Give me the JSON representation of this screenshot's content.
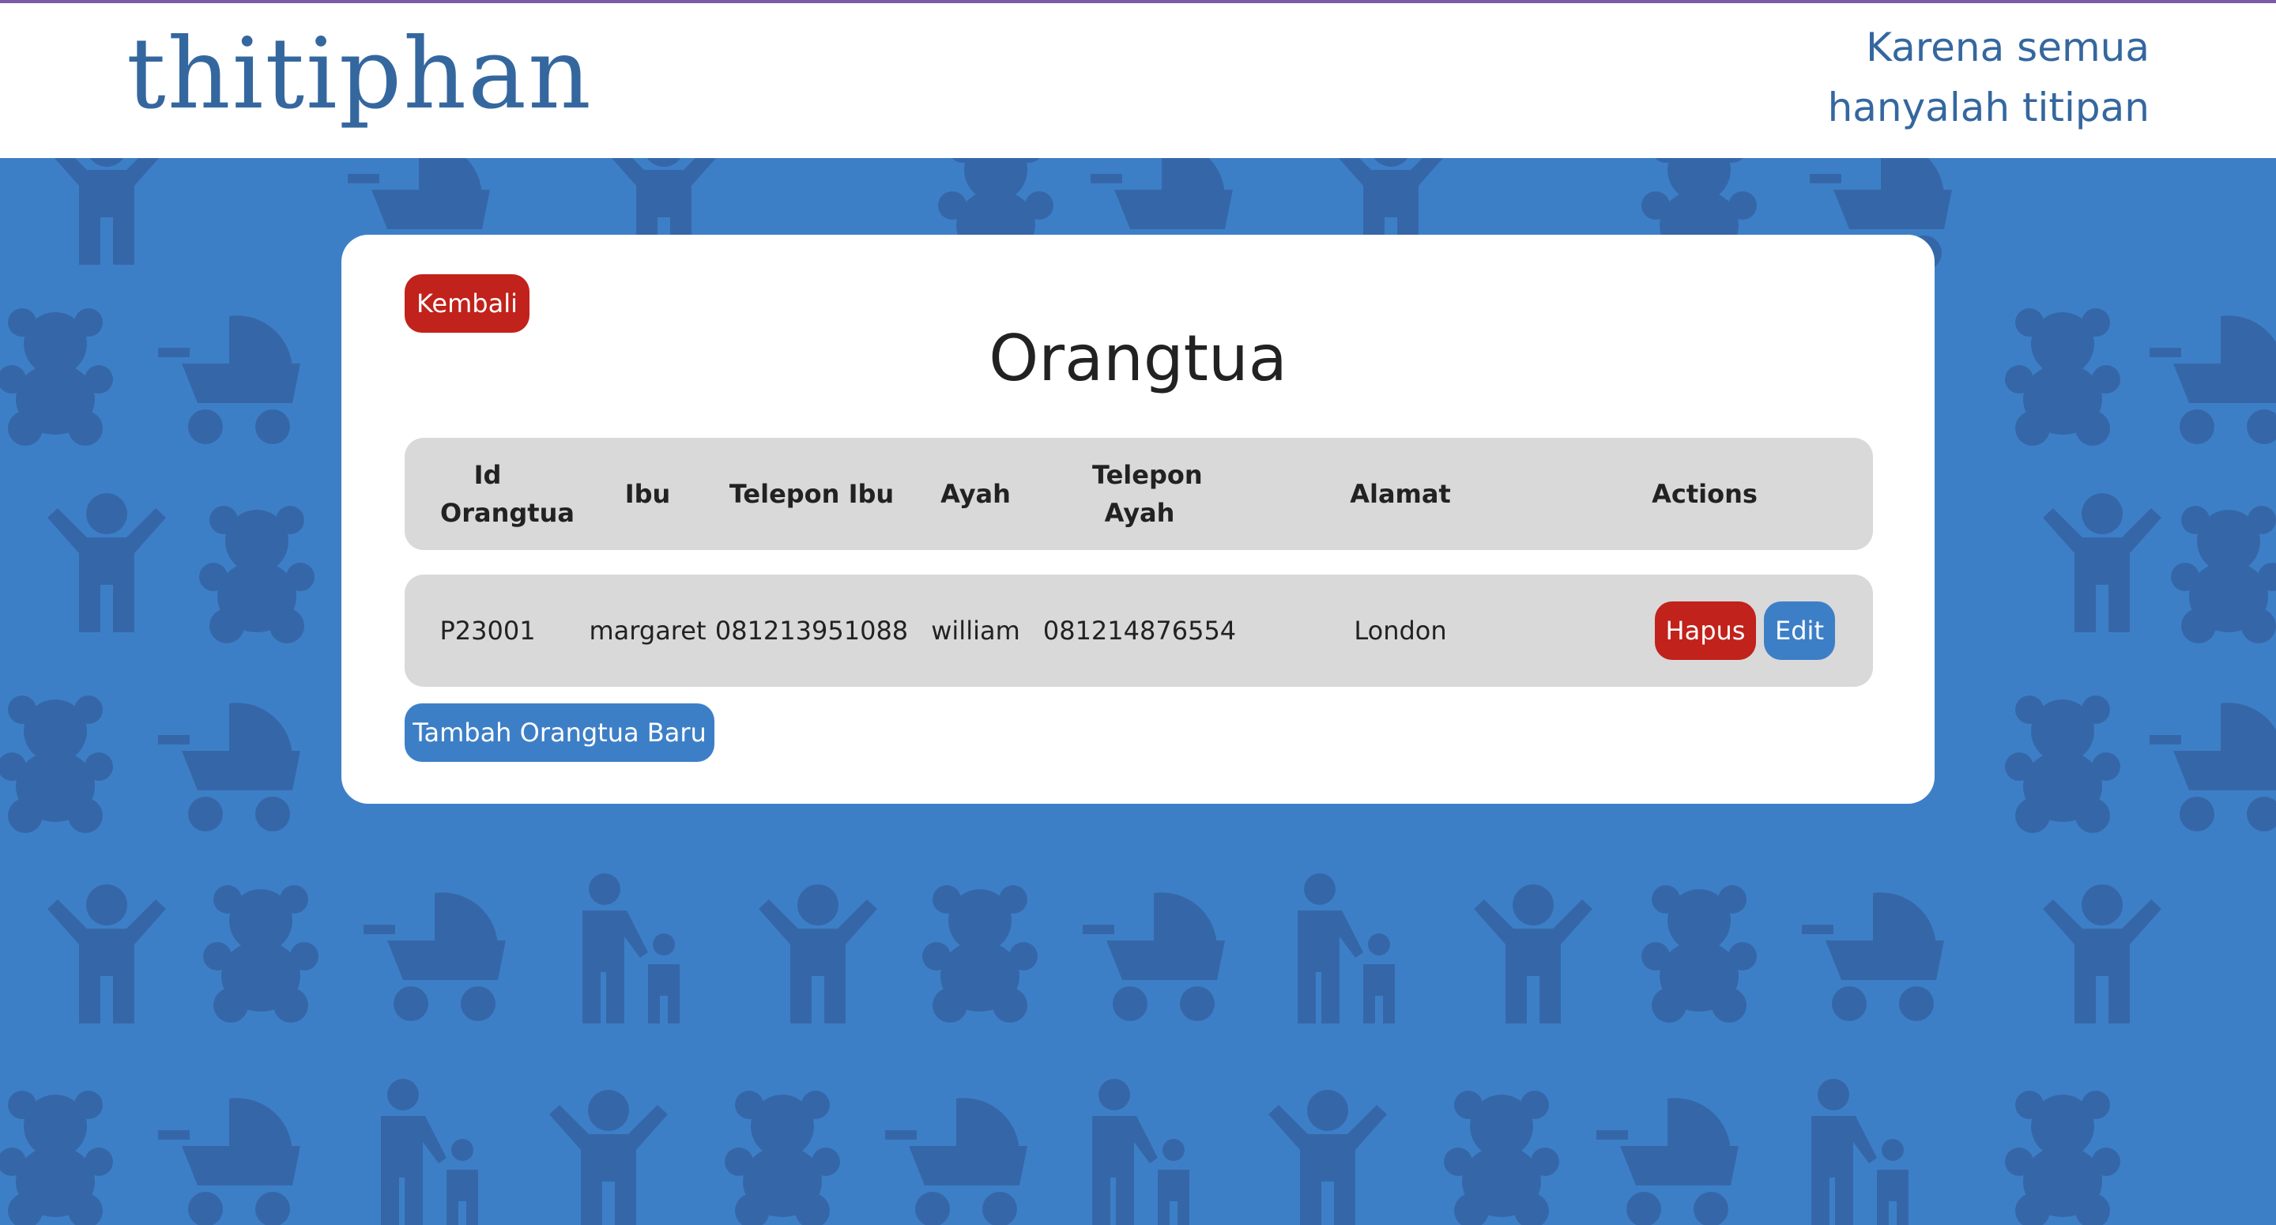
{
  "header": {
    "logo": "thitiphan",
    "tagline_line1": "Karena semua",
    "tagline_line2": "hanyalah titipan"
  },
  "page": {
    "title": "Orangtua",
    "back_label": "Kembali",
    "add_label": "Tambah Orangtua Baru"
  },
  "table": {
    "columns": [
      "Id Orangtua",
      "Ibu",
      "Telepon Ibu",
      "Ayah",
      "Telepon Ayah",
      "Alamat",
      "Actions"
    ],
    "rows": [
      {
        "id": "P23001",
        "ibu": "margaret",
        "telepon_ibu": "081213951088",
        "ayah": "william",
        "telepon_ayah": "081214876554",
        "alamat": "London",
        "delete_label": "Hapus",
        "edit_label": "Edit"
      }
    ]
  },
  "colors": {
    "background": "#3d7fc7",
    "pattern": "#3567a8",
    "brand": "#35679f",
    "danger": "#c1221b",
    "primary": "#3d7fc7",
    "table_bg": "#d9d9d9"
  },
  "icons": [
    "person-icon",
    "teddy-bear-icon",
    "stroller-icon",
    "parent-child-icon",
    "toy-car-icon",
    "shirt-icon"
  ]
}
